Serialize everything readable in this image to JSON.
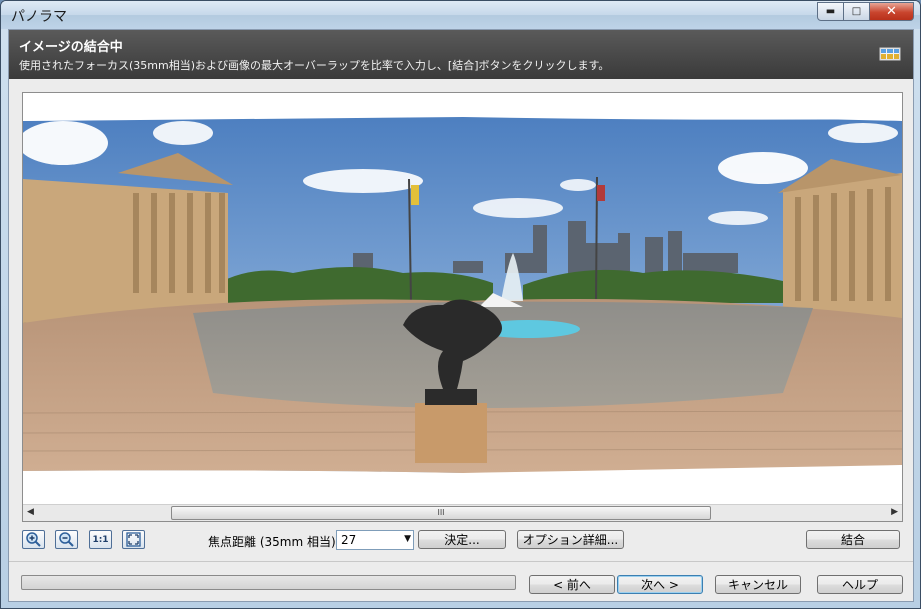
{
  "window": {
    "title": "パノラマ"
  },
  "header": {
    "title": "イメージの結合中",
    "subtitle": "使用されたフォーカス(35mm相当)および画像の最大オーバーラップを比率で入力し、[結合]ボタンをクリックします。",
    "icon": "panorama-icon"
  },
  "viewer": {
    "scroll_thumb_label": "III"
  },
  "toolbar": {
    "zoom_in_icon": "zoom-in-icon",
    "zoom_out_icon": "zoom-out-icon",
    "actual_size_label": "1:1",
    "fit_icon": "fit-to-window-icon",
    "focal_length_label": "焦点距離 (35mm 相当):",
    "focal_length_value": "27",
    "determine_label": "決定...",
    "options_label": "オプション詳細...",
    "merge_label": "結合"
  },
  "footer": {
    "back_label": "< 前へ",
    "next_label": "次へ >",
    "cancel_label": "キャンセル",
    "help_label": "ヘルプ"
  },
  "colors": {
    "header_bg": "#4a4a4a",
    "window_frame": "#c3d6ea",
    "client_bg": "#ececec"
  }
}
